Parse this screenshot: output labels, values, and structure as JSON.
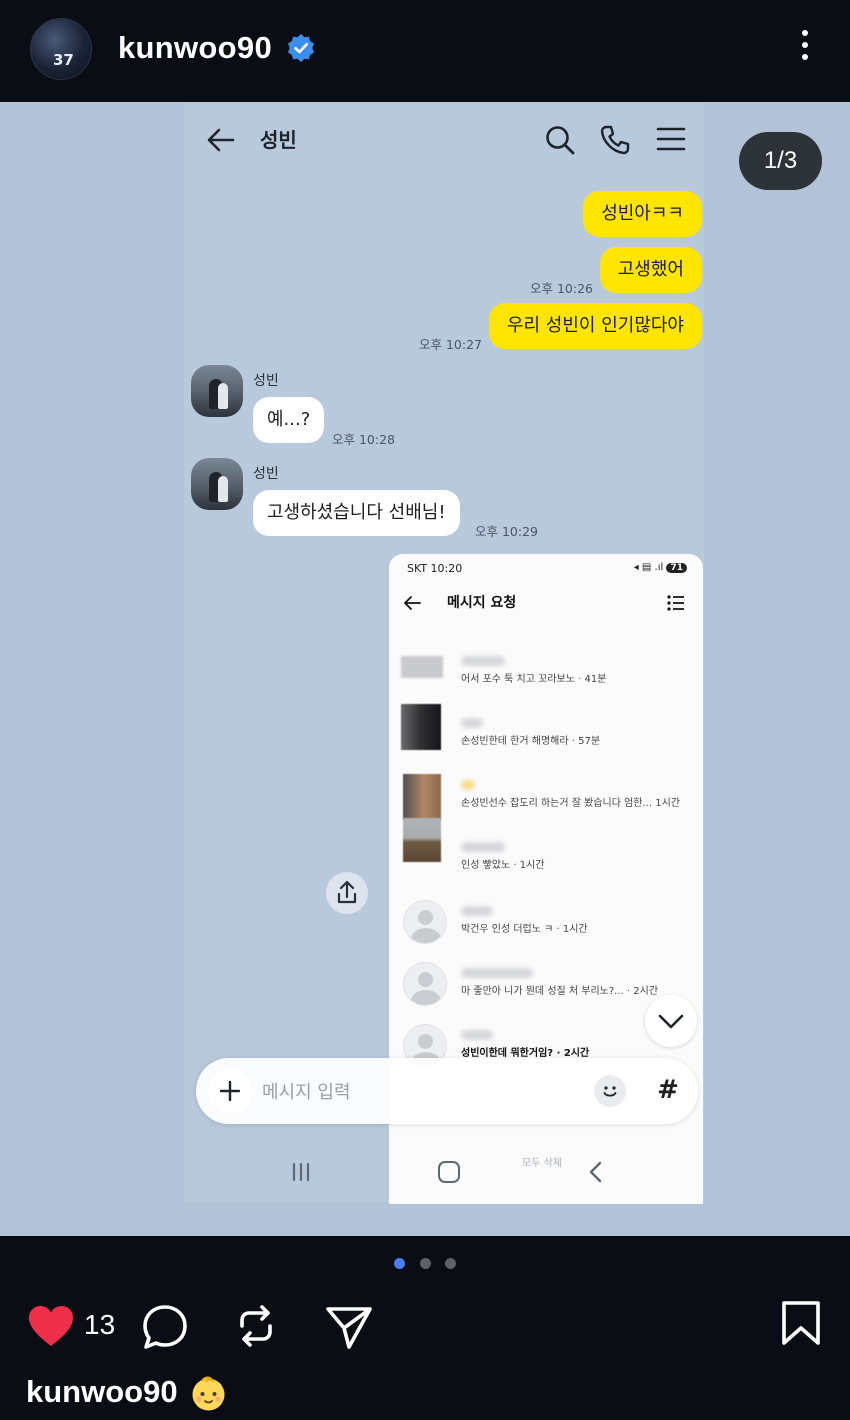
{
  "header": {
    "username": "kunwoo90",
    "avatar_number": "37",
    "verified": true
  },
  "chat": {
    "title": "성빈",
    "page_indicator": "1/3",
    "messages": [
      {
        "from": "me",
        "text": "성빈아ㅋㅋ"
      },
      {
        "from": "me",
        "text": "고생했어",
        "time": "오후 10:26"
      },
      {
        "from": "me",
        "text": "우리 성빈이 인기많다야",
        "time": "오후 10:27"
      },
      {
        "from": "other",
        "sender": "성빈",
        "text": "예...?",
        "time": "오후 10:28"
      },
      {
        "from": "other",
        "sender": "성빈",
        "text": "고생하셨습니다 선배님!",
        "time": "오후 10:29"
      }
    ],
    "input_placeholder": "메시지 입력",
    "hash_label": "#"
  },
  "attached_screenshot": {
    "status_left": "SKT 10:20",
    "battery": "71",
    "title": "메시지 요청",
    "rows": [
      {
        "preview": "어서 포수 툭 치고 꼬라보노 · 41분",
        "bold": false
      },
      {
        "preview": "손성빈한테 한거 해명해라 · 57분",
        "bold": false
      },
      {
        "preview": "손성빈선수 잡도리 하는거 잘 봤습니다 엄한... 1시간",
        "bold": false
      },
      {
        "preview": "인성 빻았노 · 1시간",
        "bold": false
      },
      {
        "preview": "박건우 인성 더럽노 ㅋ · 1시간",
        "bold": false
      },
      {
        "preview": "마 좋만아 니가 뭔데 성질 처 부리노?... · 2시간",
        "bold": false
      },
      {
        "preview": "성빈이한데 뭐한거임? · 2시간",
        "bold": true
      }
    ],
    "faint_text": "모두 삭제"
  },
  "footer": {
    "like_count": "13",
    "caption_username": "kunwoo90",
    "carousel_pages": 3,
    "carousel_active": 1
  },
  "colors": {
    "my_bubble": "#fee500",
    "chat_background": "#b9c9dc",
    "verified_badge": "#3b8ef0",
    "heart": "#f0304a",
    "active_dot": "#4a7cf2"
  }
}
